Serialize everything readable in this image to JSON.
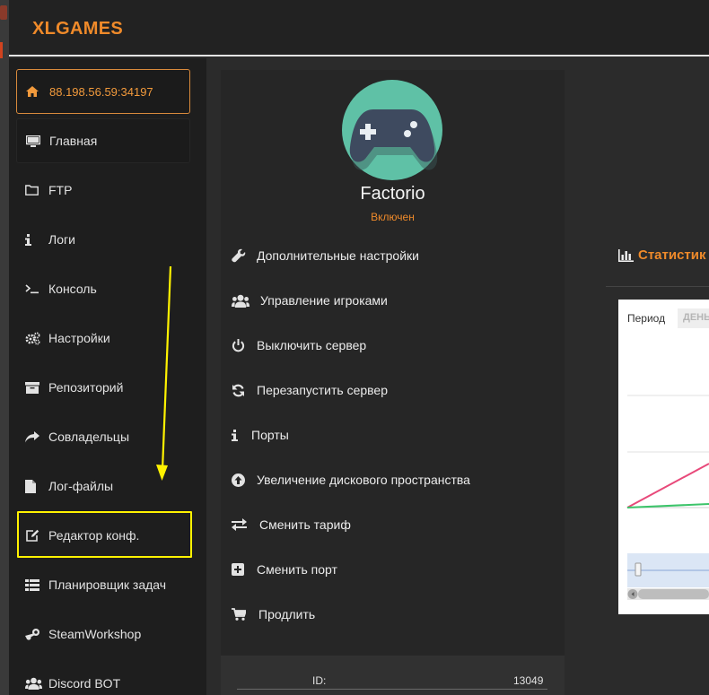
{
  "header": {
    "brand": "XLGAMES"
  },
  "sidebar": {
    "items": [
      {
        "label": "88.198.56.59:34197",
        "icon": "home-icon"
      },
      {
        "label": "Главная",
        "icon": "monitor-icon"
      },
      {
        "label": "FTP",
        "icon": "folder-icon"
      },
      {
        "label": "Логи",
        "icon": "info-icon"
      },
      {
        "label": "Консоль",
        "icon": "terminal-icon"
      },
      {
        "label": "Настройки",
        "icon": "gears-icon"
      },
      {
        "label": "Репозиторий",
        "icon": "archive-icon"
      },
      {
        "label": "Совладельцы",
        "icon": "share-icon"
      },
      {
        "label": "Лог-файлы",
        "icon": "file-icon"
      },
      {
        "label": "Редактор конф.",
        "icon": "edit-icon"
      },
      {
        "label": "Планировщик задач",
        "icon": "list-icon"
      },
      {
        "label": "SteamWorkshop",
        "icon": "steam-icon"
      },
      {
        "label": "Discord BOT",
        "icon": "users-icon"
      }
    ]
  },
  "server": {
    "name": "Factorio",
    "status": "Включен",
    "icon": "gamepad-icon"
  },
  "actions": [
    {
      "label": "Дополнительные настройки",
      "icon": "wrench-icon"
    },
    {
      "label": "Управление игроками",
      "icon": "users-icon"
    },
    {
      "label": "Выключить сервер",
      "icon": "power-icon"
    },
    {
      "label": "Перезапустить сервер",
      "icon": "refresh-icon"
    },
    {
      "label": "Порты",
      "icon": "info-icon"
    },
    {
      "label": "Увеличение дискового пространства",
      "icon": "arrow-up-circle-icon"
    },
    {
      "label": "Сменить тариф",
      "icon": "exchange-icon"
    },
    {
      "label": "Сменить порт",
      "icon": "plus-square-icon"
    },
    {
      "label": "Продлить",
      "icon": "cart-icon"
    }
  ],
  "info": {
    "id_label": "ID:",
    "id_value": "13049"
  },
  "stats": {
    "title": "Статистик",
    "period_label": "Период",
    "period_value": "ДЕНЬ",
    "series_colors": [
      "#e8497a",
      "#3cc46a"
    ]
  },
  "colors": {
    "accent": "#ef8a2a",
    "highlight": "#fff200",
    "avatar": "#5fc1a6"
  }
}
